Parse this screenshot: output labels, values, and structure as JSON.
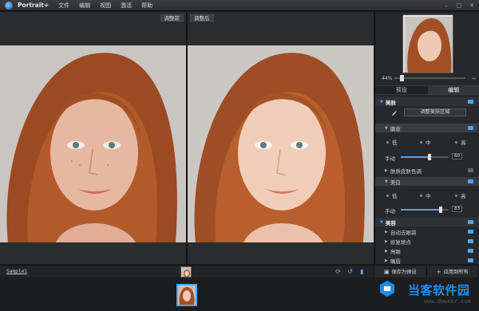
{
  "app": {
    "title": "Portrait+"
  },
  "menu": [
    "文件",
    "编辑",
    "视图",
    "激活",
    "帮助"
  ],
  "window_controls": [
    "–",
    "□",
    "✕"
  ],
  "panes": {
    "before_label": "调整前",
    "after_label": "调整后"
  },
  "navigator": {
    "zoom": "44%",
    "zoom_level": 0.08
  },
  "tabs": [
    {
      "label": "预设",
      "active": false
    },
    {
      "label": "编辑",
      "active": true
    }
  ],
  "panel": {
    "skin_section": "美肤",
    "retouch_button": "调整美肤区域",
    "smooth": {
      "label": "磨皮",
      "options": [
        "低",
        "中",
        "高"
      ],
      "slider_label": "手动",
      "slider_value": "60",
      "slider_fill": 0.6
    },
    "tone_label": "肤质皮肤色调",
    "whiten": {
      "label": "美白",
      "options": [
        "低",
        "中",
        "高"
      ],
      "slider_label": "手动",
      "slider_value": "83",
      "slider_fill": 0.83
    },
    "beauty_section": "美容",
    "beauty_items": [
      "自动去眼袋",
      "修复斑点",
      "亮眼",
      "嘴唇",
      "瘦脸"
    ]
  },
  "bottom": {
    "file_name": "Sample1",
    "save_label": "保存为预设",
    "apply_label": "应用到所有",
    "save_icon": "save-icon",
    "apply_icon": "plus-icon"
  },
  "watermark": {
    "title": "当客软件园",
    "url": "www.downkr.com"
  },
  "colors": {
    "accent": "#4ea6ff",
    "background": "#232426",
    "panel": "#27282b"
  }
}
